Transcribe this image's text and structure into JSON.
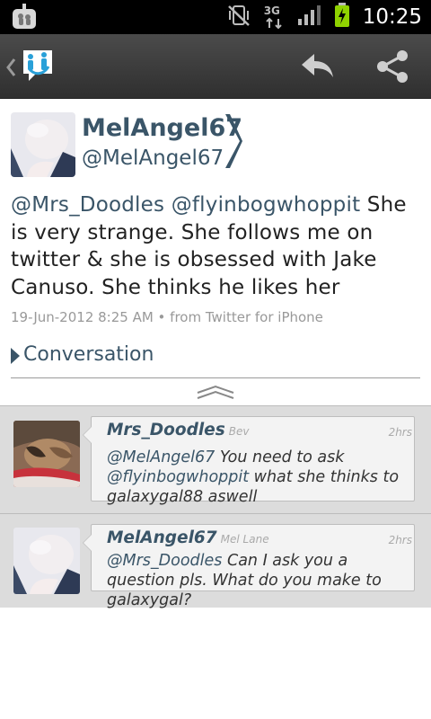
{
  "status_bar": {
    "time": "10:25",
    "network_label": "3G",
    "icons": [
      "app-notification-icon",
      "vibrate-mute-icon",
      "3g-data-icon",
      "signal-icon",
      "battery-charging-icon"
    ]
  },
  "action_bar": {
    "icons": [
      "back-chevron-icon",
      "app-logo-icon",
      "reply-icon",
      "share-icon"
    ]
  },
  "tweet": {
    "author_name": "MelAngel67",
    "author_handle": "@MelAngel67",
    "mention_1": "@Mrs_Doodles",
    "mention_2": "@flyinbogwhoppit",
    "body": " She is very strange. She follows me on twitter & she is obsessed with Jake Canuso. She thinks he likes her",
    "meta": "19-Jun-2012 8:25 AM • from Twitter for iPhone"
  },
  "conversation": {
    "label": "Conversation",
    "items": [
      {
        "name": "Mrs_Doodles",
        "real_name": "Bev",
        "time": "2hrs",
        "mention_1": "@MelAngel67",
        "text_1": " You need to ask ",
        "mention_2": "@flyinbogwhoppit",
        "text_2": " what she thinks to galaxygal88 aswell"
      },
      {
        "name": "MelAngel67",
        "real_name": "Mel Lane",
        "time": "2hrs",
        "mention_1": "@Mrs_Doodles",
        "text_1": " Can I ask you a question pls. What do you make to galaxygal?"
      }
    ]
  },
  "colors": {
    "accent": "#3a5568",
    "status_bar": "#000000",
    "action_bar": "#3c3c3c",
    "conversation_bg": "#dcdcdc",
    "bubble_bg": "#f3f3f3"
  }
}
